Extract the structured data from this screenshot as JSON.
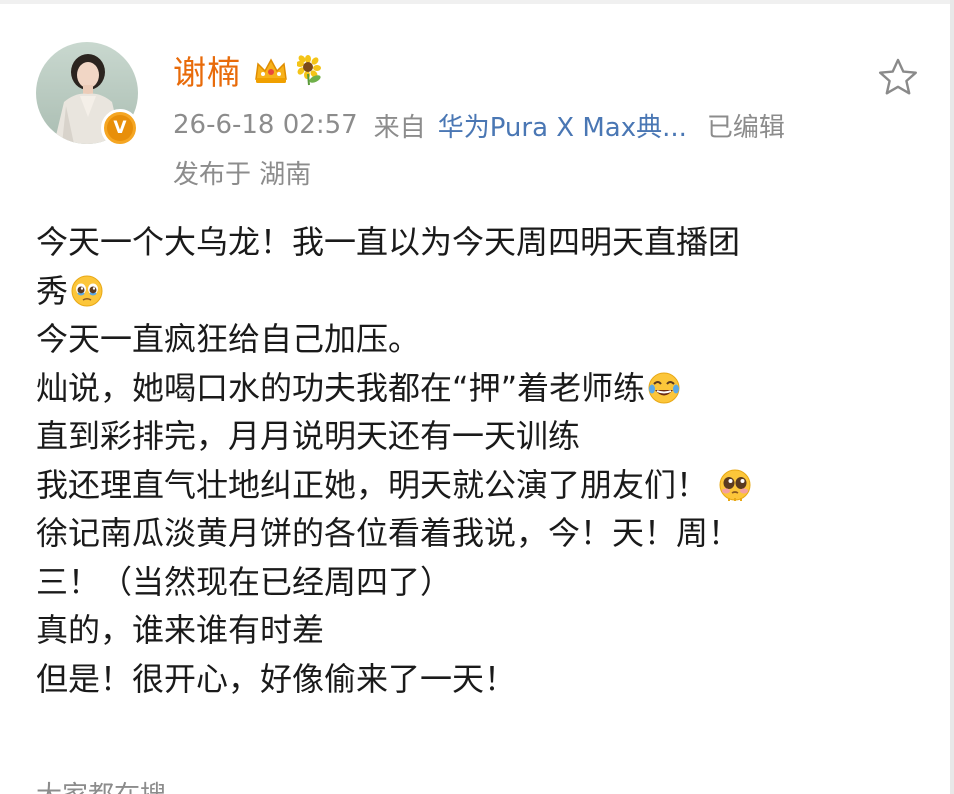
{
  "post": {
    "author": {
      "name": "谢楠",
      "verified_badge": "V",
      "avatar_icon": "user-avatar",
      "badges": [
        "crown-icon",
        "sunflower-icon"
      ]
    },
    "timestamp": "26-6-18 02:57",
    "source_prefix": "来自",
    "source_device": "华为Pura X Max典...",
    "edited": "已编辑",
    "location": "发布于 湖南",
    "favorite_icon": "star-outline-icon",
    "body_lines": [
      {
        "text": "今天一个大乌龙！我一直以为今天周四明天直播团",
        "emoji": ""
      },
      {
        "text": "秀",
        "emoji": "teary-eyed-face"
      },
      {
        "text": "今天一直疯狂给自己加压。",
        "emoji": ""
      },
      {
        "text": "灿说，她喝口水的功夫我都在“押”着老师练",
        "emoji": "tears-of-joy-face"
      },
      {
        "text": "直到彩排完，月月说明天还有一天训练",
        "emoji": ""
      },
      {
        "text": "我还理直气壮地纠正她，明天就公演了朋友们！",
        "emoji": "pleading-face"
      },
      {
        "text": "徐记南瓜淡黄月饼的各位看着我说，今！天！周！",
        "emoji": ""
      },
      {
        "text": "三！（当然现在已经周四了）",
        "emoji": ""
      },
      {
        "text": "真的，谁来谁有时差",
        "emoji": ""
      },
      {
        "text": "但是！很开心，好像偷来了一天！",
        "emoji": ""
      }
    ],
    "footer_partial": "大家都在搜"
  },
  "colors": {
    "name": "#e86b0a",
    "meta": "#8c8c8c",
    "device_link": "#4a77b4",
    "verified": "#f5a623",
    "body_text": "#1a1a1a"
  }
}
